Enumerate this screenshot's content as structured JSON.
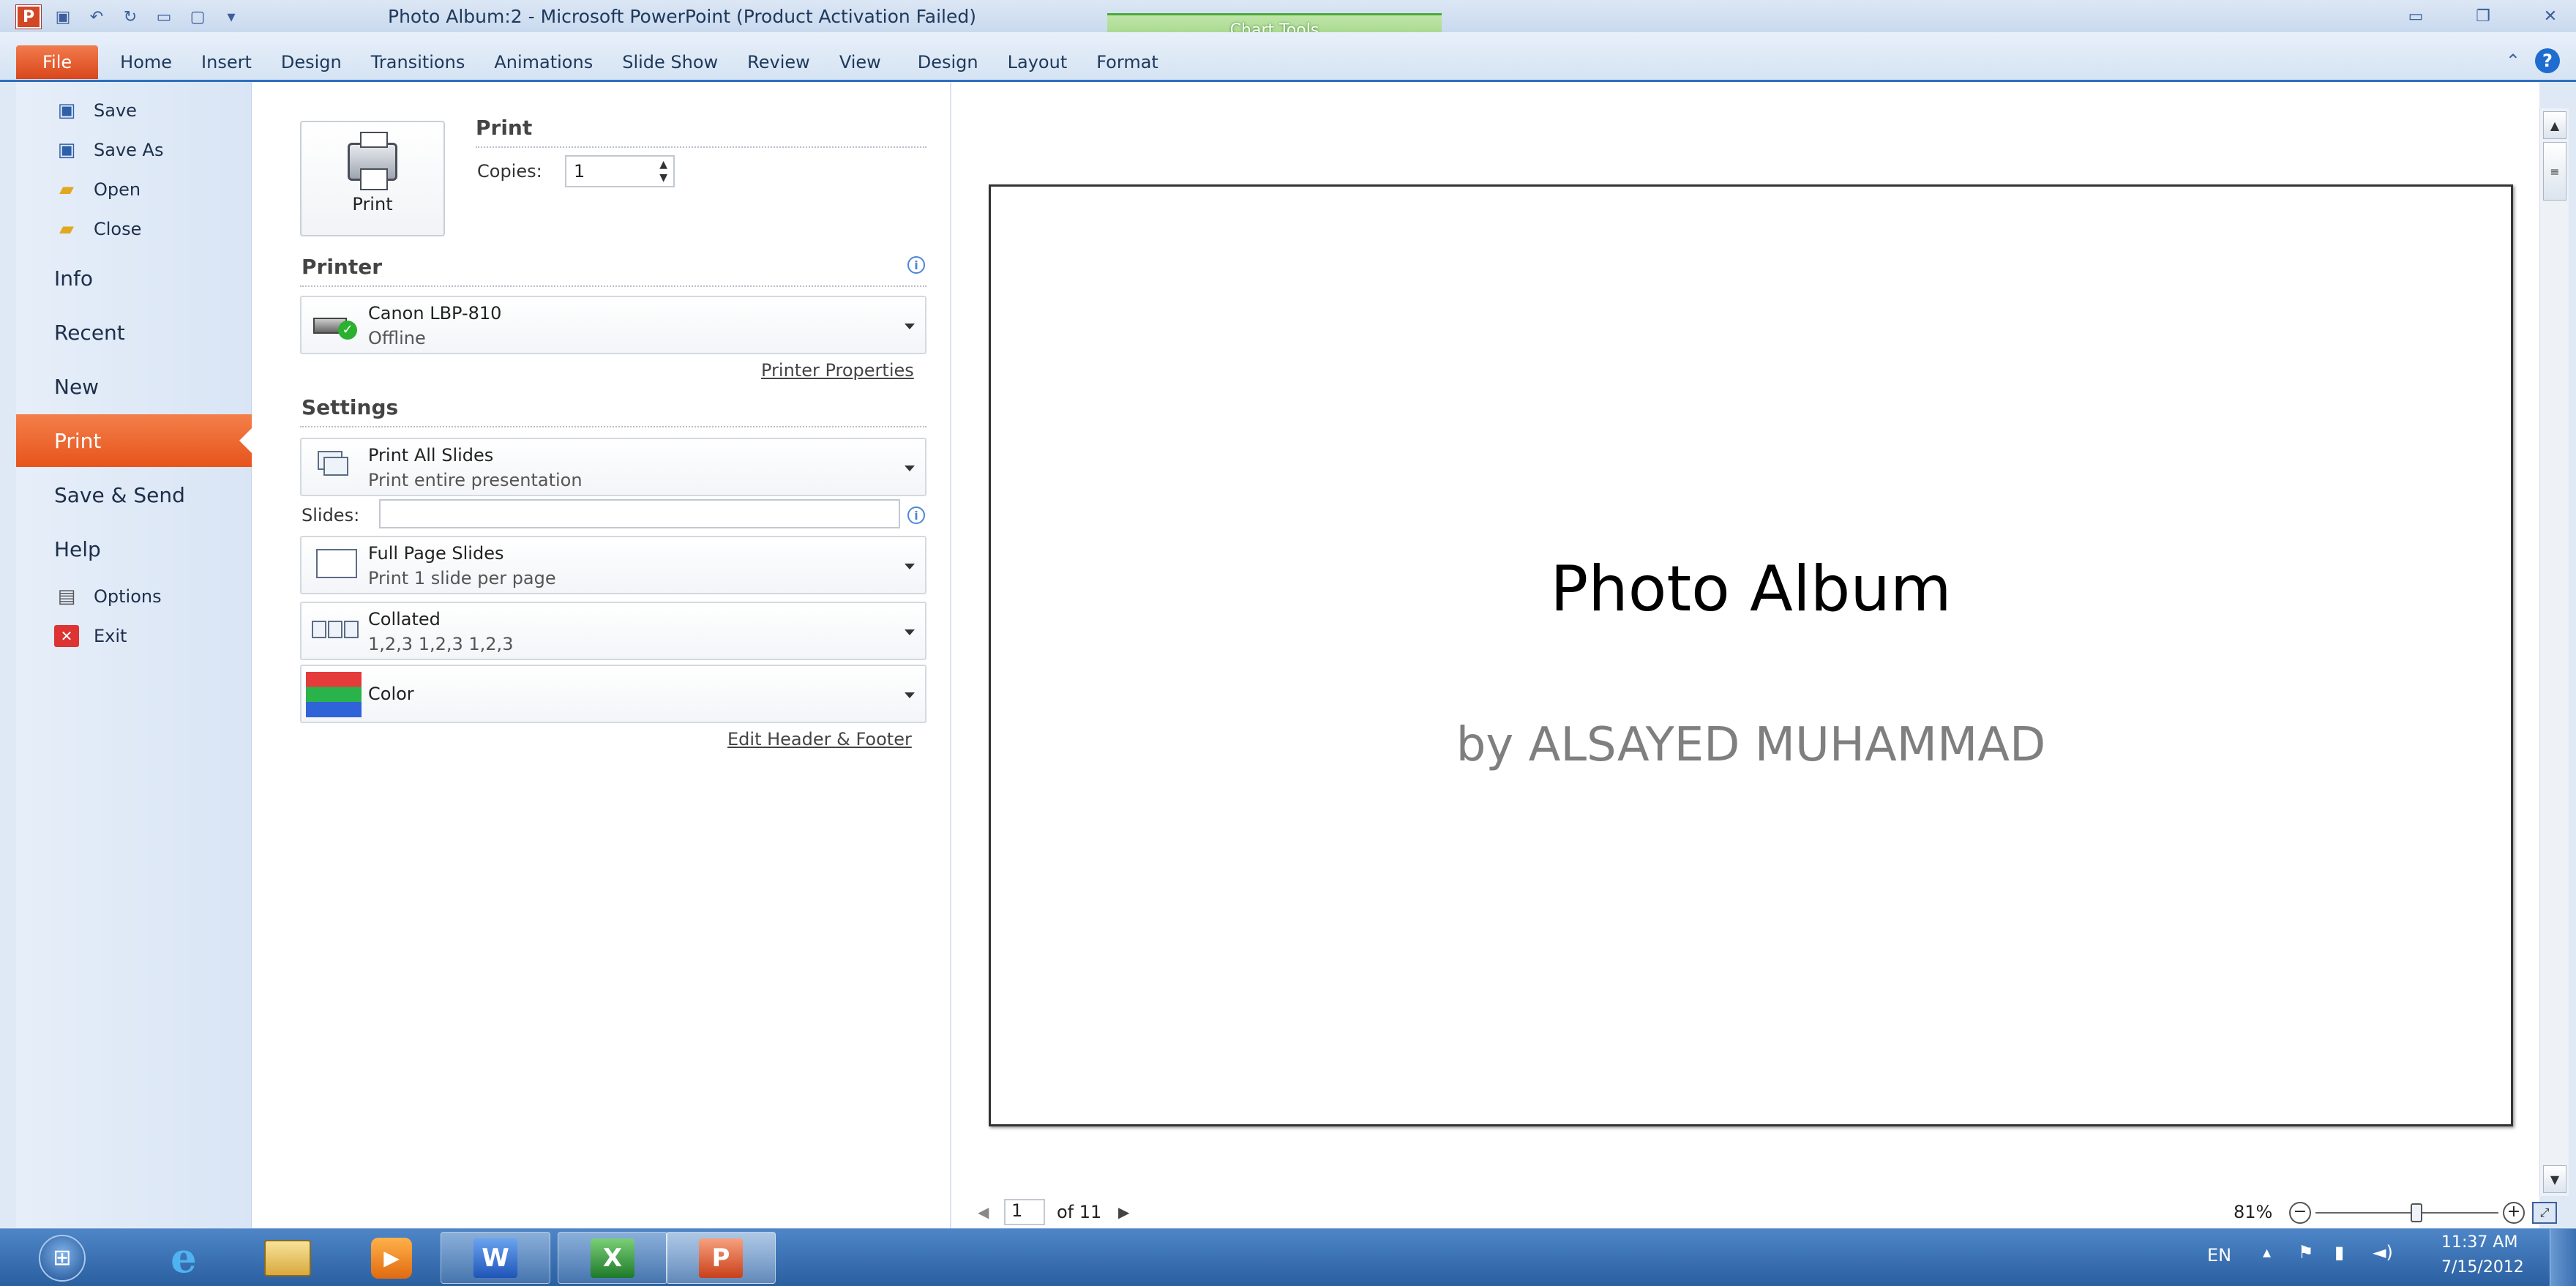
{
  "window": {
    "title": "Photo Album:2  -  Microsoft PowerPoint (Product Activation Failed)",
    "contextual_group": "Chart Tools"
  },
  "ribbon_tabs": [
    "File",
    "Home",
    "Insert",
    "Design",
    "Transitions",
    "Animations",
    "Slide Show",
    "Review",
    "View"
  ],
  "contextual_tabs": [
    "Design",
    "Layout",
    "Format"
  ],
  "backstage": {
    "items_small_top": [
      "Save",
      "Save As",
      "Open",
      "Close"
    ],
    "items_big": [
      "Info",
      "Recent",
      "New",
      "Print",
      "Save & Send",
      "Help"
    ],
    "items_small_bottom": [
      "Options",
      "Exit"
    ],
    "selected": "Print"
  },
  "print": {
    "section_title": "Print",
    "button_label": "Print",
    "copies_label": "Copies:",
    "copies_value": "1",
    "printer_header": "Printer",
    "printer_name": "Canon LBP-810",
    "printer_status": "Offline",
    "printer_properties_link": "Printer Properties",
    "settings_header": "Settings",
    "range": {
      "main": "Print All Slides",
      "sub": "Print entire presentation"
    },
    "slides_label": "Slides:",
    "slides_value": "",
    "layout": {
      "main": "Full Page Slides",
      "sub": "Print 1 slide per page"
    },
    "collation": {
      "main": "Collated",
      "sub": "1,2,3   1,2,3   1,2,3"
    },
    "color": {
      "main": "Color"
    },
    "header_footer_link": "Edit Header & Footer"
  },
  "preview": {
    "slide_title": "Photo Album",
    "slide_subtitle": "by ALSAYED MUHAMMAD",
    "page_current": "1",
    "page_total": "of 11",
    "zoom": "81%",
    "zoom_fraction": 0.55
  },
  "taskbar": {
    "language": "EN",
    "time": "11:37 AM",
    "date": "7/15/2012",
    "apps": [
      "start",
      "internet-explorer",
      "file-explorer",
      "media-player",
      "word",
      "excel",
      "powerpoint"
    ]
  },
  "colors": {
    "accent_file": "#e2531d",
    "chart_tools": "#9ed285",
    "taskbar": "#2a5fa0",
    "ribbon_border": "#2e6fbf"
  }
}
